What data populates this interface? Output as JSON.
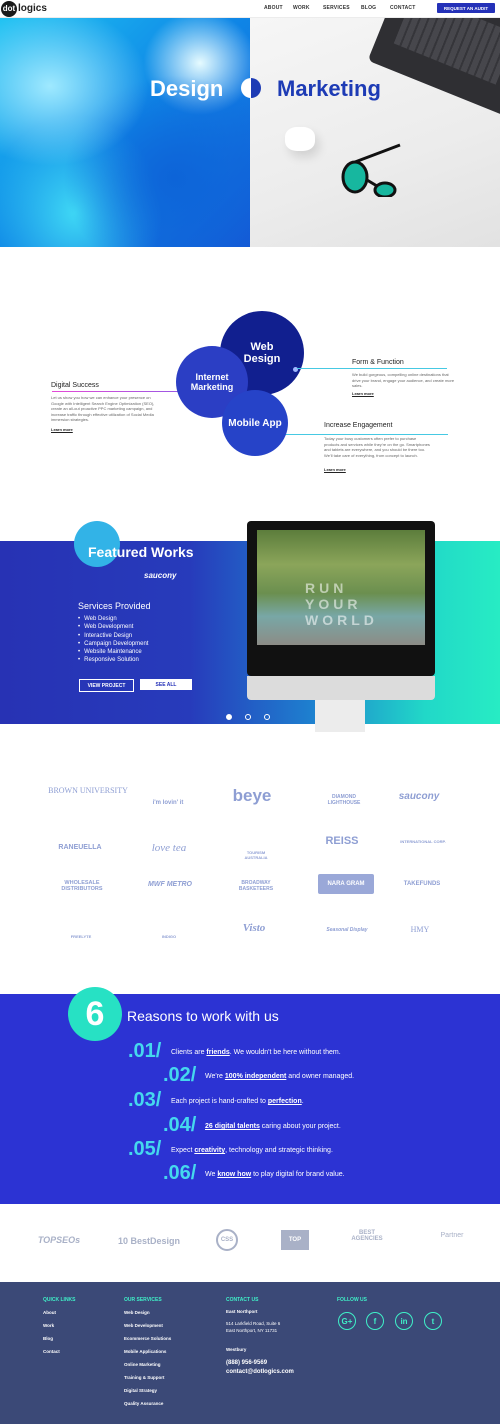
{
  "nav": {
    "logo_mark": "dot",
    "logo_text": "logics",
    "links": [
      "ABOUT",
      "WORK",
      "SERVICES",
      "BLOG",
      "CONTACT"
    ],
    "cta": "REQUEST AN AUDIT"
  },
  "hero": {
    "left_title": "Design",
    "right_title": "Marketing"
  },
  "services": {
    "circles": {
      "web": "Web Design",
      "internet": "Internet Marketing",
      "mobile": "Mobile App"
    },
    "digital_success": {
      "title": "Digital Success",
      "text": "Let us show you how we can enhance your presence on Google with Intelligent Search Engine Optimization (SEO), create an all-out proactive PPC marketing campaign, and increase traffic through effective utilization of Social Media immersion strategies.",
      "link": "Learn more"
    },
    "form_function": {
      "title": "Form & Function",
      "text": "We build gorgeous, compelling online destinations that drive your brand, engage your audience, and create more sales.",
      "link": "Learn more"
    },
    "engagement": {
      "title": "Increase Engagement",
      "text": "Today your busy customers often prefer to purchase products and services while they're on the go. Smartphones and tablets are everywhere, and you should be there too. We'll take care of everything, from concept to launch.",
      "link": "Learn more"
    }
  },
  "featured": {
    "title": "Featured Works",
    "brand": "saucony",
    "services_title": "Services Provided",
    "services": [
      "Web Design",
      "Web Development",
      "Interactive Design",
      "Campaign Development",
      "Website Maintenance",
      "Responsive Solution"
    ],
    "view_project": "VIEW PROJECT",
    "see_all": "SEE ALL",
    "screen_text": "RUN YOUR WORLD"
  },
  "clients": [
    "BROWN UNIVERSITY",
    "i'm lovin' it",
    "beye",
    "DIAMOND LIGHTHOUSE",
    "saucony",
    "RANEUELLA",
    "love tea",
    "TOURISM AUSTRALIA",
    "REISS",
    "INTERNATIONAL CORP.",
    "WHOLESALE DISTRIBUTORS",
    "MWF METRO",
    "BROADWAY BASKETEERS",
    "NARA GRAM",
    "TAKEFUNDS",
    "FREELYTE",
    "INDIGO",
    "Visto",
    "Seasonal Display",
    "HMY"
  ],
  "reasons": {
    "number": "6",
    "title": "Reasons to work with us",
    "items": [
      {
        "num": ".01/",
        "pre": "Clients are ",
        "bold": "friends",
        "post": ". We wouldn't be here without them."
      },
      {
        "num": ".02/",
        "pre": "We're ",
        "bold": "100% independent",
        "post": " and owner managed."
      },
      {
        "num": ".03/",
        "pre": "Each project is hand-crafted to ",
        "bold": "perfection",
        "post": "."
      },
      {
        "num": ".04/",
        "pre": "",
        "bold": "26 digital talents",
        "post": " caring about your project."
      },
      {
        "num": ".05/",
        "pre": "Expect ",
        "bold": "creativity",
        "post": ", technology and strategic thinking."
      },
      {
        "num": ".06/",
        "pre": "We ",
        "bold": "know how",
        "post": " to play digital for brand value."
      }
    ]
  },
  "awards": [
    "TOPSEOs",
    "10 BestDesign",
    "CSS",
    "TOP",
    "BEST AGENCIES",
    "Partner"
  ],
  "footer": {
    "quick_links": {
      "title": "QUICK LINKS",
      "items": [
        "About",
        "Work",
        "Blog",
        "Contact"
      ]
    },
    "our_services": {
      "title": "OUR SERVICES",
      "items": [
        "Web Design",
        "Web Development",
        "Ecommerce Solutions",
        "Mobile Applications",
        "Online Marketing",
        "Training & Support",
        "Digital Strategy",
        "Quality Assurance"
      ]
    },
    "contact": {
      "title": "CONTACT US",
      "office1": "East Northport",
      "address1": "514 Larkfield Road, Suite 6",
      "address2": "East Northport, NY 11731",
      "office2": "Westbury",
      "phone": "(888) 956-9569",
      "email": "contact@dotlogics.com"
    },
    "follow": {
      "title": "FOLLOW US",
      "icons": [
        "G+",
        "f",
        "in",
        "t"
      ]
    }
  }
}
